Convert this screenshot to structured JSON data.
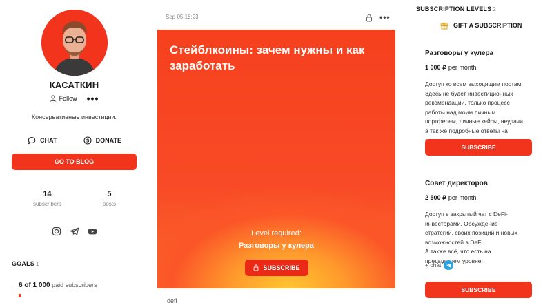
{
  "author": {
    "name": "КАСАТКИН",
    "follow_label": "Follow",
    "more_label": "•••",
    "bio": "Консервативные инвестиции.",
    "chat_label": "CHAT",
    "donate_label": "DONATE",
    "go_blog_label": "GO TO BLOG",
    "stats": [
      {
        "value": "14",
        "label": "subscribers"
      },
      {
        "value": "5",
        "label": "posts"
      }
    ],
    "socials": [
      "instagram-icon",
      "telegram-icon",
      "youtube-icon"
    ],
    "accent_color": "#f2341c"
  },
  "goals": {
    "title": "GOALS",
    "count": "1",
    "progress_text": "6 of 1 000",
    "progress_suffix": "paid subscribers",
    "progress_fraction": 0.006
  },
  "post": {
    "date": "Sep 05 18:23",
    "more_label": "•••",
    "title": "Стейблкоины: зачем нужны и как заработать",
    "level_required_label": "Level required:",
    "level_name": "Разговоры у кулера",
    "subscribe_label": "SUBSCRIBE",
    "tag": "defi"
  },
  "subscription": {
    "title": "SUBSCRIPTION LEVELS",
    "count": "2",
    "gift_label": "GIFT A SUBSCRIPTION",
    "tiers": [
      {
        "name": "Разговоры у кулера",
        "price": "1 000 ₽",
        "period": "per month",
        "description": "Доступ ко всем выходящим постам.\nЗдесь не будет инвестиционных\nрекомендаций, только процесс\nработы над моим личным\nпортфелем, личные кейсы, неудачи,\nа так же подробные ответы на\nважные вопросы от подписчиков.",
        "subscribe_label": "SUBSCRIBE"
      },
      {
        "name": "Совет директоров",
        "price": "2 500 ₽",
        "period": "per month",
        "description": "Доступ в закрытый чат с DeFi-\nинвесторами. Обсуждение\nстратегий, своих позиций и новых\nвозможностей в DeFi.\nА также всё, что есть на\nпредыдущем уровне.",
        "chat_label": "+ chat",
        "subscribe_label": "SUBSCRIBE"
      }
    ]
  }
}
